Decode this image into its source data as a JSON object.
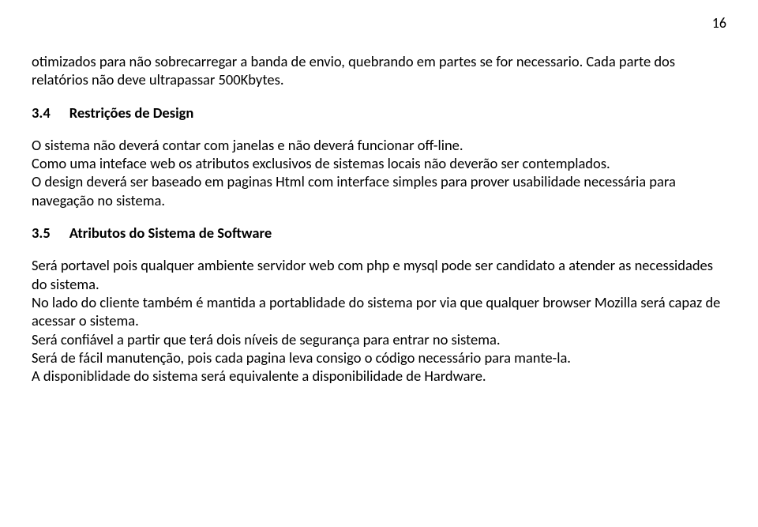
{
  "pageNumber": "16",
  "para1": "otimizados para não sobrecarregar a banda de envio, quebrando em partes se for necessario. Cada parte dos relatórios não deve ultrapassar 500Kbytes.",
  "heading34_num": "3.4",
  "heading34_title": "Restrições de Design",
  "para34a": "O sistema não deverá contar com janelas e não deverá funcionar off-line.",
  "para34b": "Como uma inteface web os atributos exclusivos de sistemas locais não deverão ser contemplados.",
  "para34c": "O design deverá ser baseado em paginas Html com interface simples para prover usabilidade necessária para navegação no sistema.",
  "heading35_num": "3.5",
  "heading35_title": "Atributos do Sistema de Software",
  "para35a": "Será portavel pois qualquer ambiente servidor web com php e mysql pode ser candidato a atender as necessidades do sistema.",
  "para35b": "No lado do cliente também é mantida a portablidade do sistema por via que qualquer browser Mozilla será capaz de acessar o sistema.",
  "para35c": "Será confiável a partir que terá dois níveis de segurança para entrar no sistema.",
  "para35d": "Será de fácil manutenção, pois cada pagina leva consigo o código necessário para mante-la.",
  "para35e": "A disponiblidade do sistema será equivalente a disponibilidade de Hardware."
}
